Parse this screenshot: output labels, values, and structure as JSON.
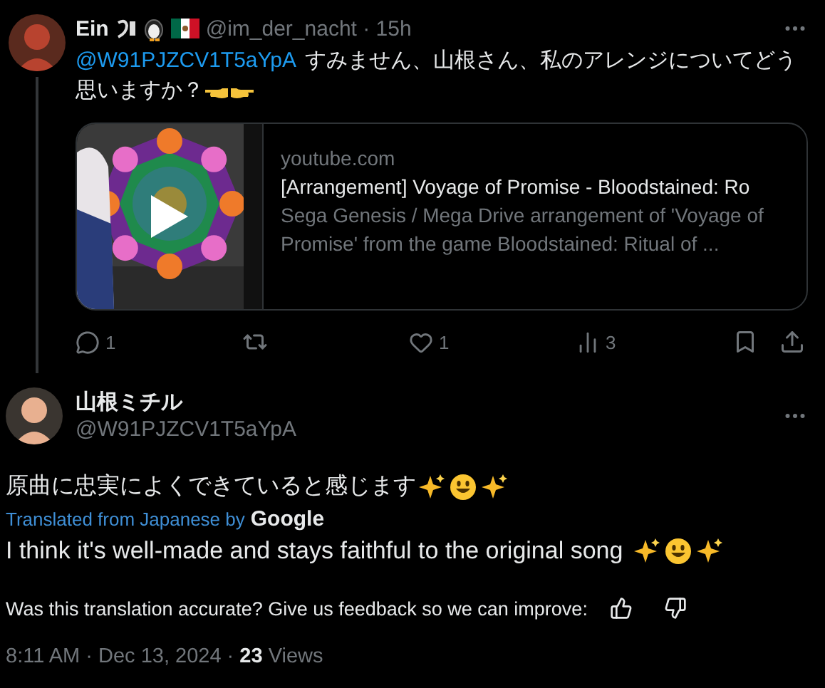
{
  "reply_to": {
    "author": {
      "name": "Ein",
      "meta": "@im_der_nacht · 15h"
    },
    "mention": "@W91PJZCV1T5aYpA",
    "text": "すみません、山根さん、私のアレンジについてどう思いますか？",
    "link_card": {
      "domain": "youtube.com",
      "title": "[Arrangement] Voyage of Promise - Bloodstained: Ro",
      "description": "Sega Genesis / Mega Drive arrangement of 'Voyage of Promise' from the game Bloodstained: Ritual of ..."
    },
    "actions": [
      {
        "kind": "reply",
        "count": "1"
      },
      {
        "kind": "repost"
      },
      {
        "kind": "like",
        "count": "1"
      },
      {
        "kind": "views",
        "count": "3"
      },
      {
        "kind": "bookmark"
      },
      {
        "kind": "share"
      }
    ]
  },
  "tweet": {
    "author": {
      "name": "山根ミチル",
      "handle": "@W91PJZCV1T5aYpA"
    },
    "text": "原曲に忠実によくできていると感じます",
    "translation_label": "Translated from Japanese by",
    "translation_provider": "Google",
    "translation": "I think it's well-made and stays faithful to the original song",
    "feedback_prompt": "Was this translation accurate? Give us feedback so we can improve:",
    "timestamp": "8:11 AM · Dec 13, 2024 · **23** Views"
  }
}
